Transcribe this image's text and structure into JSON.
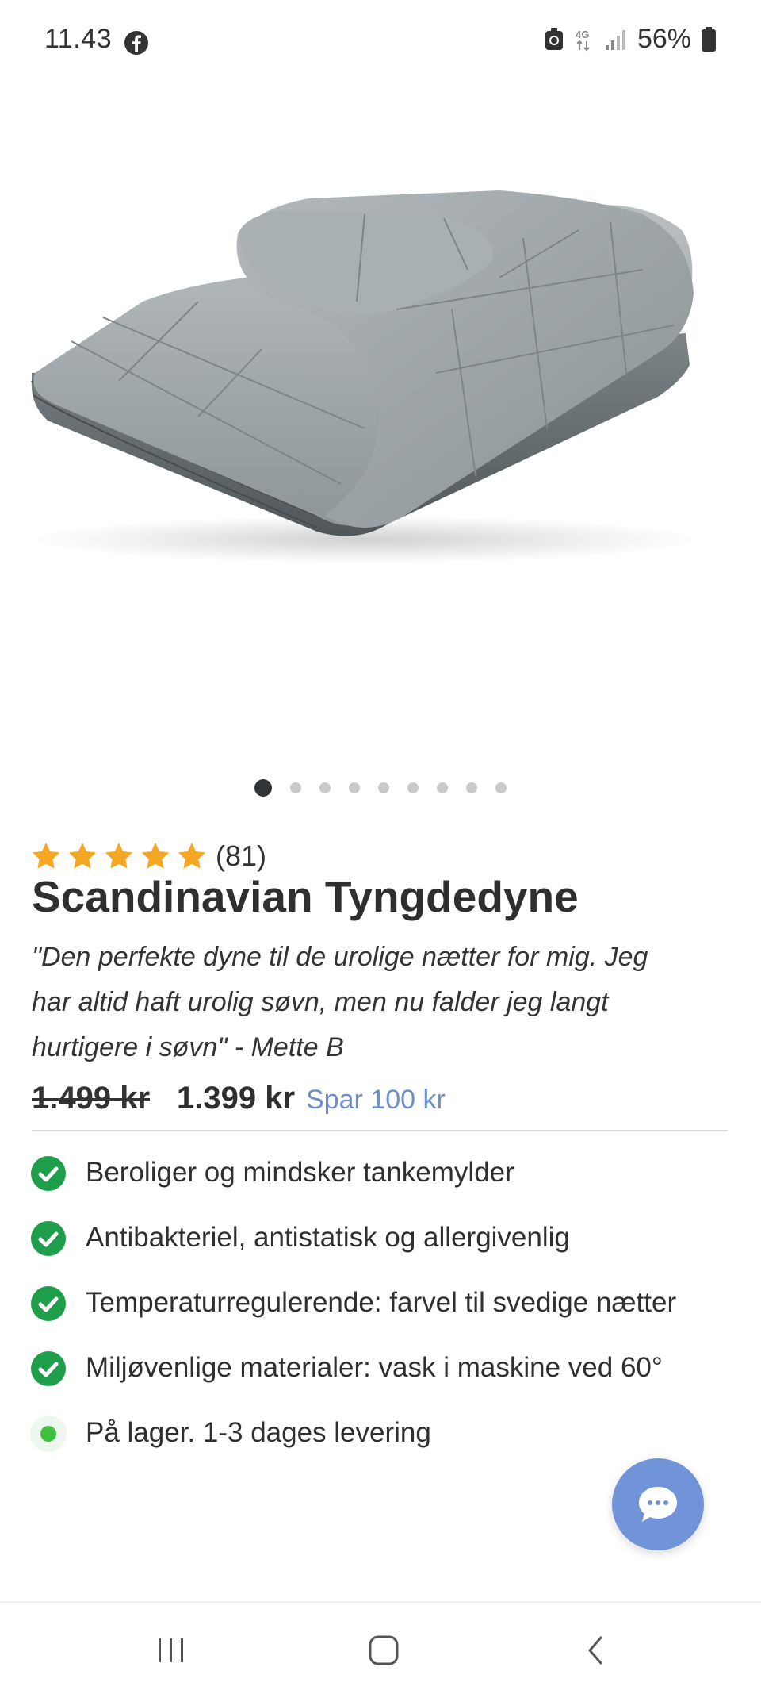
{
  "status_bar": {
    "time": "11.43",
    "battery_percent": "56%",
    "icons": [
      "facebook-icon",
      "battery-saver-icon",
      "network-4g-icon",
      "signal-icon",
      "battery-icon"
    ]
  },
  "product": {
    "image_alt": "weighted-blanket-image",
    "gallery": {
      "total": 9,
      "active_index": 0
    },
    "rating": {
      "stars": 5,
      "count": "(81)"
    },
    "title": "Scandinavian Tyngdedyne",
    "quote_lines": [
      "\"Den perfekte dyne til de urolige nætter for mig. Jeg",
      "har altid haft urolig søvn, men nu falder jeg langt",
      "hurtigere i søvn\" - Mette B"
    ],
    "price": {
      "old": "1.499 kr",
      "new": "1.399 kr",
      "save": "Spar 100 kr"
    },
    "features": [
      "Beroliger og mindsker tankemylder",
      "Antibakteriel, antistatisk og allergivenlig",
      "Temperaturregulerende: farvel til svedige nætter",
      "Miljøvenlige materialer: vask i maskine ved 60°"
    ],
    "stock": "På lager. 1-3 dages levering"
  },
  "chat": {
    "icon": "chat-bubble-icon"
  },
  "nav_bar": {
    "icons": [
      "recent-apps-icon",
      "home-icon",
      "back-icon"
    ]
  },
  "colors": {
    "accent": "#7194d8",
    "save_text": "#6e8fc9",
    "check": "#1e9e4a",
    "star": "#f5a623",
    "stock_dot": "#3fbf3f"
  }
}
